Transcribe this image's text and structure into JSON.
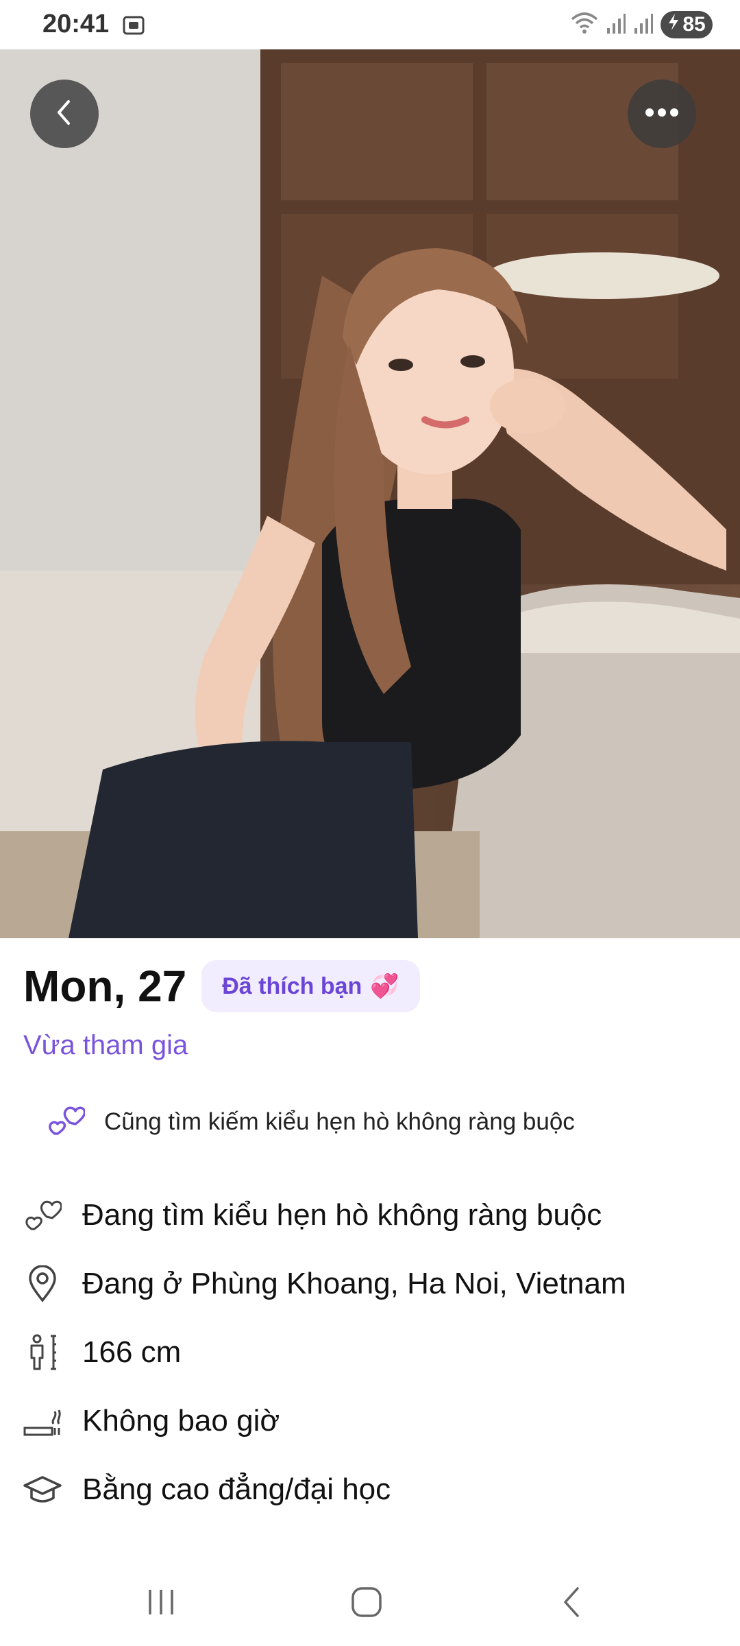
{
  "status_bar": {
    "time": "20:41",
    "battery": "85",
    "icons": [
      "screenshot-icon",
      "wifi-icon",
      "signal-icon",
      "signal-icon",
      "battery-charging-icon"
    ]
  },
  "header": {
    "back_icon": "chevron-left-icon",
    "more_icon": "more-horizontal-icon"
  },
  "profile": {
    "name_age": "Mon, 27",
    "liked_badge": "Đã thích bạn",
    "liked_emoji": "💞",
    "joined_status": "Vừa tham gia",
    "match_note": "Cũng tìm kiếm kiểu hẹn hò không ràng buộc",
    "attributes": [
      {
        "icon": "hearts-icon",
        "label": "Đang tìm kiểu hẹn hò không ràng buộc"
      },
      {
        "icon": "location-pin-icon",
        "label": "Đang ở Phùng Khoang, Ha Noi, Vietnam"
      },
      {
        "icon": "height-icon",
        "label": "166 cm"
      },
      {
        "icon": "smoking-icon",
        "label": "Không bao giờ"
      },
      {
        "icon": "graduation-cap-icon",
        "label": "Bằng cao đẳng/đại học"
      }
    ]
  },
  "colors": {
    "accent": "#7a53dd",
    "badge_bg": "#f1edff",
    "badge_text": "#6b45d6"
  },
  "nav_bar": {
    "icons": [
      "recent-apps-icon",
      "home-icon",
      "back-icon"
    ]
  }
}
